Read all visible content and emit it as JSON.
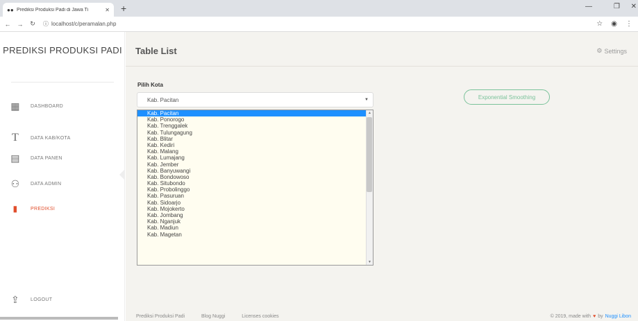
{
  "browser": {
    "tab_title": "Prediksi Produksi Padi di Jawa Ti",
    "url": "localhost/c/peramalan.php"
  },
  "sidebar": {
    "brand": "PREDIKSI PRODUKSI PADI",
    "items": [
      {
        "label": "DASHBOARD",
        "icon": "chart-icon"
      },
      {
        "label": "DATA KAB/KOTA",
        "icon": "text-icon"
      },
      {
        "label": "DATA PANEN",
        "icon": "table-icon"
      },
      {
        "label": "DATA ADMIN",
        "icon": "user-icon"
      },
      {
        "label": "PREDIKSI",
        "icon": "pin-icon"
      }
    ],
    "logout": "LOGOUT"
  },
  "header": {
    "title": "Table List",
    "settings": "Settings"
  },
  "form": {
    "label": "Pilih Kota",
    "selected": "Kab. Pacitan",
    "button": "Exponential Smoothing",
    "options": [
      "Kab. Pacitan",
      "Kab. Ponorogo",
      "Kab. Trenggalek",
      "Kab. Tulungagung",
      "Kab. Blitar",
      "Kab. Kediri",
      "Kab. Malang",
      "Kab. Lumajang",
      "Kab. Jember",
      "Kab. Banyuwangi",
      "Kab. Bondowoso",
      "Kab. Situbondo",
      "Kab. Probolinggo",
      "Kab. Pasuruan",
      "Kab. Sidoarjo",
      "Kab. Mojokerto",
      "Kab. Jombang",
      "Kab. Nganjuk",
      "Kab. Madiun",
      "Kab. Magetan"
    ]
  },
  "footer": {
    "links": [
      "Prediksi Produksi Padi",
      "Blog Nuggi",
      "Licenses cookies"
    ],
    "credit_prefix": "© 2019, made with",
    "credit_by": "by",
    "author": "Nuggi Libon"
  },
  "colors": {
    "accent": "#e14e2c",
    "success": "#7ac29a",
    "selection": "#1e90ff"
  }
}
